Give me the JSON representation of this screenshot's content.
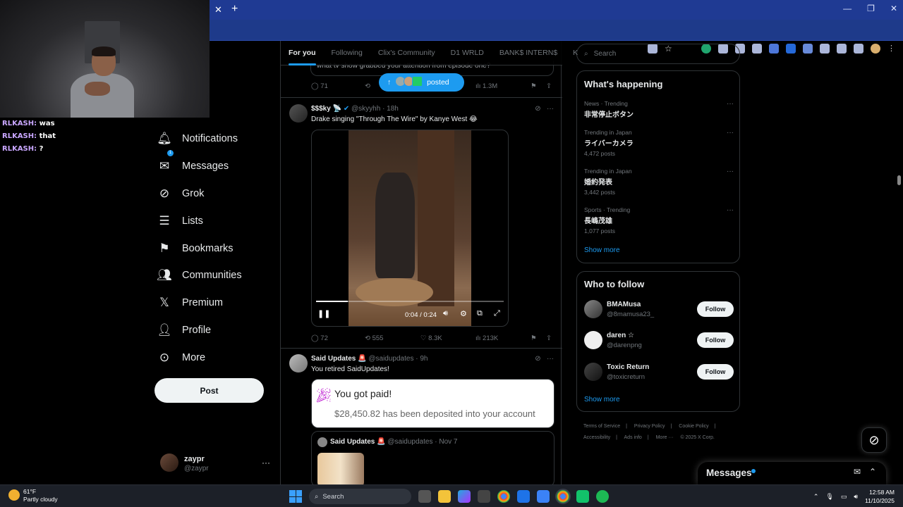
{
  "webcam_chat": [
    {
      "user": "RLKASH:",
      "message": "was"
    },
    {
      "user": "RLKASH:",
      "message": "that"
    },
    {
      "user": "RLKASH:",
      "message": "?"
    }
  ],
  "nav": {
    "items": [
      {
        "label": "Notifications",
        "icon": "bell-icon"
      },
      {
        "label": "Messages",
        "icon": "envelope-icon",
        "badge": "1"
      },
      {
        "label": "Grok",
        "icon": "grok-icon"
      },
      {
        "label": "Lists",
        "icon": "list-icon"
      },
      {
        "label": "Bookmarks",
        "icon": "bookmark-icon"
      },
      {
        "label": "Communities",
        "icon": "people-icon"
      },
      {
        "label": "Premium",
        "icon": "x-logo-icon"
      },
      {
        "label": "Profile",
        "icon": "person-icon"
      },
      {
        "label": "More",
        "icon": "more-circle-icon"
      }
    ],
    "post_button": "Post",
    "account": {
      "name": "zaypr",
      "handle": "@zaypr"
    }
  },
  "feed": {
    "tabs": [
      "For you",
      "Following",
      "Clix's Community",
      "D1 WRLD",
      "BANK$ INTERN$",
      "K"
    ],
    "active_tab": "For you",
    "prev_tweet": {
      "text": "what tv show grabbed your attention from episode one?",
      "replies": "71",
      "views": "1.3M"
    },
    "posted_pill": "posted",
    "tweet1": {
      "name": "$$$ky",
      "handle": "@skyyhh",
      "time": "· 18h",
      "text": "Drake singing \"Through The Wire\" by Kanye West 😂",
      "video_time": "0:04 / 0:24",
      "video_progress": 0.17,
      "replies": "72",
      "reposts": "555",
      "likes": "8.3K",
      "views": "213K"
    },
    "tweet2": {
      "name": "Said Updates",
      "handle": "@saidupdates",
      "time": "· 9h",
      "text": "You retired SaidUpdates!",
      "card_title": "You got paid!",
      "card_text": "$28,450.82 has been deposited into your account",
      "quote_name": "Said Updates",
      "quote_handle": "@saidupdates",
      "quote_time": "· Nov 7"
    }
  },
  "right": {
    "search_placeholder": "Search",
    "happening_title": "What's happening",
    "trends": [
      {
        "category": "News · Trending",
        "name": "非常停止ボタン",
        "count": ""
      },
      {
        "category": "Trending in Japan",
        "name": "ライバーカメラ",
        "count": "4,472 posts"
      },
      {
        "category": "Trending in Japan",
        "name": "婚約発表",
        "count": "3,442 posts"
      },
      {
        "category": "Sports · Trending",
        "name": "長嶋茂雄",
        "count": "1,077 posts"
      }
    ],
    "show_more": "Show more",
    "wtf_title": "Who to follow",
    "who_to_follow": [
      {
        "name": "BMAMusa",
        "handle": "@8mamusa23_",
        "button": "Follow"
      },
      {
        "name": "daren ☆",
        "handle": "@darenpng",
        "button": "Follow"
      },
      {
        "name": "Toxic Return",
        "handle": "@toxicreturn",
        "button": "Follow"
      }
    ],
    "footer": [
      "Terms of Service",
      "|",
      "Privacy Policy",
      "|",
      "Cookie Policy",
      "|",
      "Accessibility",
      "|",
      "Ads info",
      "|",
      "More ···",
      "© 2025 X Corp."
    ]
  },
  "messages_drawer": {
    "title": "Messages"
  },
  "taskbar": {
    "weather_temp": "61°F",
    "weather_desc": "Partly cloudy",
    "search": "Search",
    "time": "12:58 AM",
    "date": "11/10/2025"
  }
}
